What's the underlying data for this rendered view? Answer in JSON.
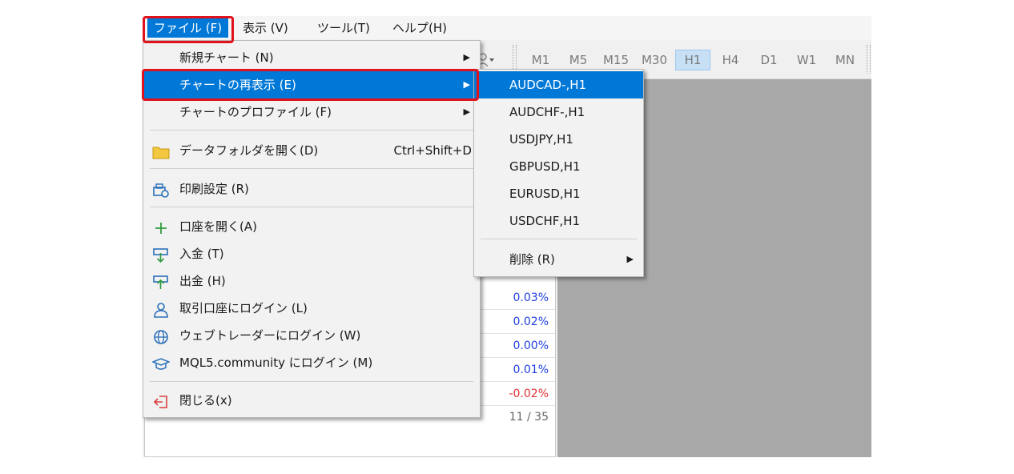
{
  "menubar": {
    "items": [
      {
        "label": "ファイル (F)",
        "active": true
      },
      {
        "label": "表示 (V)"
      },
      {
        "label": "ツール(T)"
      },
      {
        "label": "ヘルプ(H)"
      }
    ]
  },
  "toolbar": {
    "timeframes": [
      "M1",
      "M5",
      "M15",
      "M30",
      "H1",
      "H4",
      "D1",
      "W1",
      "MN"
    ],
    "selected": "H1"
  },
  "market_watch": {
    "rows": [
      "0.03%",
      "0.02%",
      "0.00%",
      "0.01%",
      "-0.02%",
      "11 / 35"
    ]
  },
  "file_menu": {
    "items": [
      {
        "label": "新規チャート (N)",
        "icon": "none",
        "submenu": true
      },
      {
        "label": "チャートの再表示 (E)",
        "icon": "none",
        "submenu": true,
        "highlighted": true
      },
      {
        "label": "チャートのプロファイル (F)",
        "icon": "none",
        "submenu": true
      },
      {
        "label": "データフォルダを開く(D)",
        "icon": "folder-icon",
        "shortcut": "Ctrl+Shift+D"
      },
      {
        "label": "印刷設定 (R)",
        "icon": "print-setup-icon"
      },
      {
        "label": "口座を開く(A)",
        "icon": "plus-icon"
      },
      {
        "label": "入金 (T)",
        "icon": "deposit-icon"
      },
      {
        "label": "出金 (H)",
        "icon": "withdraw-icon"
      },
      {
        "label": "取引口座にログイン (L)",
        "icon": "user-icon"
      },
      {
        "label": "ウェブトレーダーにログイン (W)",
        "icon": "globe-icon"
      },
      {
        "label": "MQL5.community にログイン (M)",
        "icon": "mortarboard-icon"
      },
      {
        "label": "閉じる(x)",
        "icon": "exit-icon"
      }
    ],
    "submenu_arrow": "▶"
  },
  "reopen_submenu": {
    "items": [
      {
        "label": "AUDCAD-,H1",
        "highlighted": true
      },
      {
        "label": "AUDCHF-,H1"
      },
      {
        "label": "USDJPY,H1"
      },
      {
        "label": "GBPUSD,H1"
      },
      {
        "label": "EURUSD,H1"
      },
      {
        "label": "USDCHF,H1"
      }
    ],
    "delete_label": "削除 (R)"
  },
  "colors": {
    "highlight": "#0078d7",
    "annotation_red": "#e0131d",
    "chart_bg": "#a8a8a8",
    "positive": "#1f3fe0",
    "negative": "#e03030"
  }
}
